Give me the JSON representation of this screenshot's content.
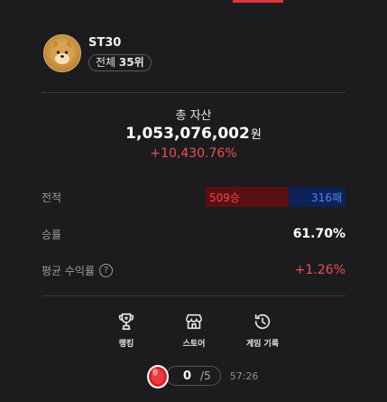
{
  "profile": {
    "username": "ST30",
    "rank_prefix": "전체",
    "rank_value": "35위"
  },
  "assets": {
    "label": "총 자산",
    "value": "1,053,076,002",
    "unit": "원",
    "change": "+10,430.76%"
  },
  "stats": {
    "record_label": "전적",
    "wins": "509승",
    "losses": "316패",
    "win_rate_label": "승률",
    "win_rate": "61.70%",
    "avg_return_label": "평균 수익률",
    "avg_return": "+1.26%",
    "help_symbol": "?"
  },
  "actions": [
    {
      "label": "랭킹",
      "icon": "trophy-icon"
    },
    {
      "label": "스토어",
      "icon": "store-icon"
    },
    {
      "label": "게임 기록",
      "icon": "history-icon"
    }
  ],
  "energy": {
    "current": "0",
    "max": "/5",
    "timer": "57:26",
    "icon": "red-gem-icon"
  },
  "colors": {
    "background": "#1c1c1e",
    "accent_red": "#ea4f55",
    "win_bar": "#5c0f12",
    "loss_bar": "#0f2257",
    "loss_text": "#4e88ea"
  }
}
